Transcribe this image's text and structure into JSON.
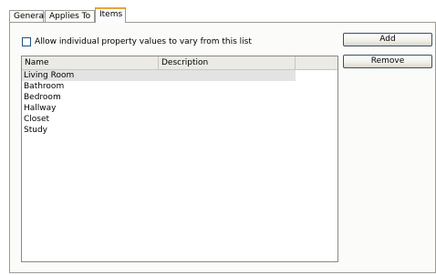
{
  "tabs": [
    {
      "label": "General"
    },
    {
      "label": "Applies To"
    },
    {
      "label": "Items",
      "active": true
    }
  ],
  "checkbox": {
    "label": "Allow individual property values to vary from this list",
    "checked": false
  },
  "list": {
    "columns": [
      "Name",
      "Description"
    ],
    "rows": [
      {
        "name": "Living Room",
        "description": ""
      },
      {
        "name": "Bathroom",
        "description": ""
      },
      {
        "name": "Bedroom",
        "description": ""
      },
      {
        "name": "Hallway",
        "description": ""
      },
      {
        "name": "Closet",
        "description": ""
      },
      {
        "name": "Study",
        "description": ""
      }
    ],
    "selected_index": 0
  },
  "buttons": {
    "add_label": "Add",
    "remove_label": "Remove"
  },
  "colors": {
    "active_tab_accent": "#e8a33a",
    "selection": "#e3e3e3",
    "panel_bg": "#fbfbf9"
  }
}
